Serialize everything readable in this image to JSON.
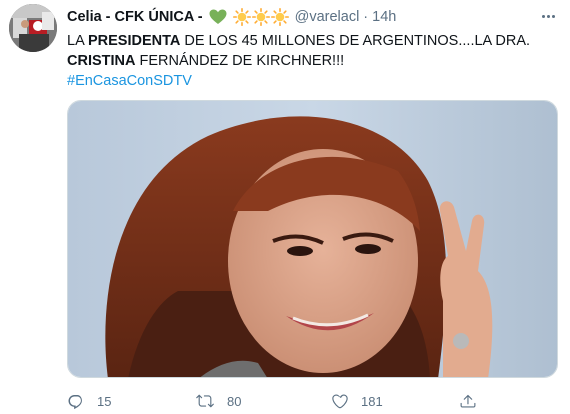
{
  "tweet": {
    "author": {
      "display_name": "Celia - CFK ÚNICA -",
      "handle": "@varelacl",
      "separator": "·",
      "timestamp": "14h",
      "name_emojis": [
        "green-heart",
        "sun",
        "sun",
        "sun"
      ]
    },
    "text": {
      "line1_prefix": "LA ",
      "line1_bold": "PRESIDENTA",
      "line1_suffix": " DE LOS 45 MILLONES DE ARGENTINOS....LA DRA.",
      "line2_bold": "CRISTINA",
      "line2_suffix": " FERNÁNDEZ DE KIRCHNER!!!",
      "hashtag": "#EnCasaConSDTV"
    },
    "actions": {
      "reply_count": "15",
      "retweet_count": "80",
      "like_count": "181",
      "share_label": ""
    },
    "icons": {
      "more": "more-horizontal-icon",
      "reply": "reply-icon",
      "retweet": "retweet-icon",
      "like": "heart-icon",
      "share": "share-icon"
    },
    "colors": {
      "text": "#0f1419",
      "secondary": "#5b7083",
      "link": "#1b95e0",
      "emoji_heart": "#78b159",
      "emoji_sun": "#ffac33"
    }
  }
}
